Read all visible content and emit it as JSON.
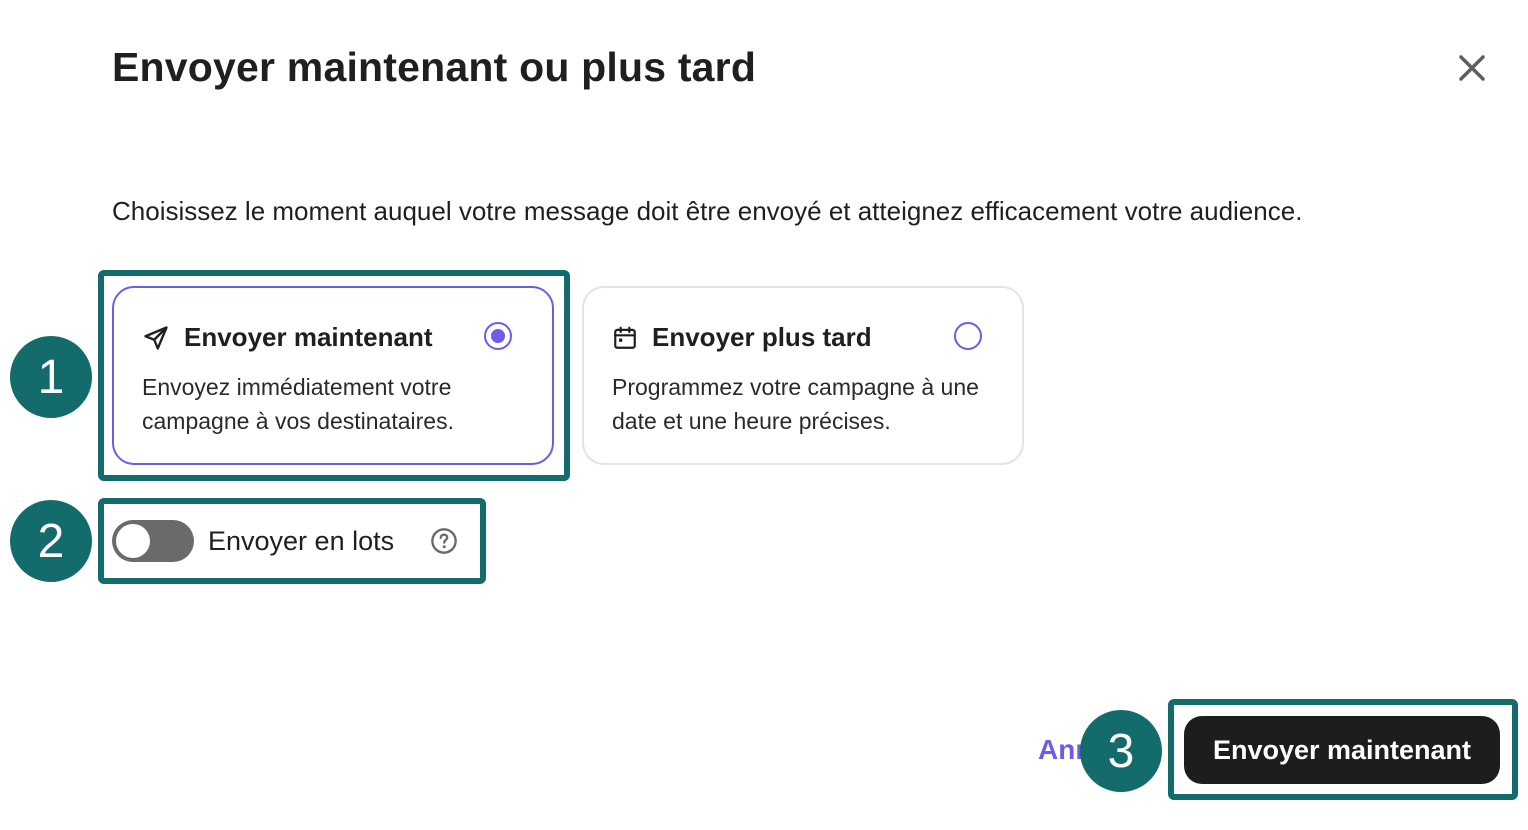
{
  "dialog": {
    "title": "Envoyer maintenant ou plus tard",
    "description": "Choisissez le moment auquel votre message doit être envoyé et atteignez efficacement votre audience."
  },
  "options": [
    {
      "title": "Envoyer maintenant",
      "body": "Envoyez immédiatement votre campagne à vos destinataires.",
      "icon": "send-icon",
      "selected": true
    },
    {
      "title": "Envoyer plus tard",
      "body": "Programmez votre campagne à une date et une heure précises.",
      "icon": "calendar-icon",
      "selected": false
    }
  ],
  "batch": {
    "label": "Envoyer en lots",
    "enabled": false
  },
  "footer": {
    "cancel_label": "Annuler",
    "primary_label": "Envoyer maintenant"
  },
  "steps": [
    "1",
    "2",
    "3"
  ],
  "colors": {
    "accent": "#6c5ce7",
    "highlight": "#136b6b",
    "primary_button": "#1d1d1d",
    "toggle_off": "#6a6a6a"
  }
}
